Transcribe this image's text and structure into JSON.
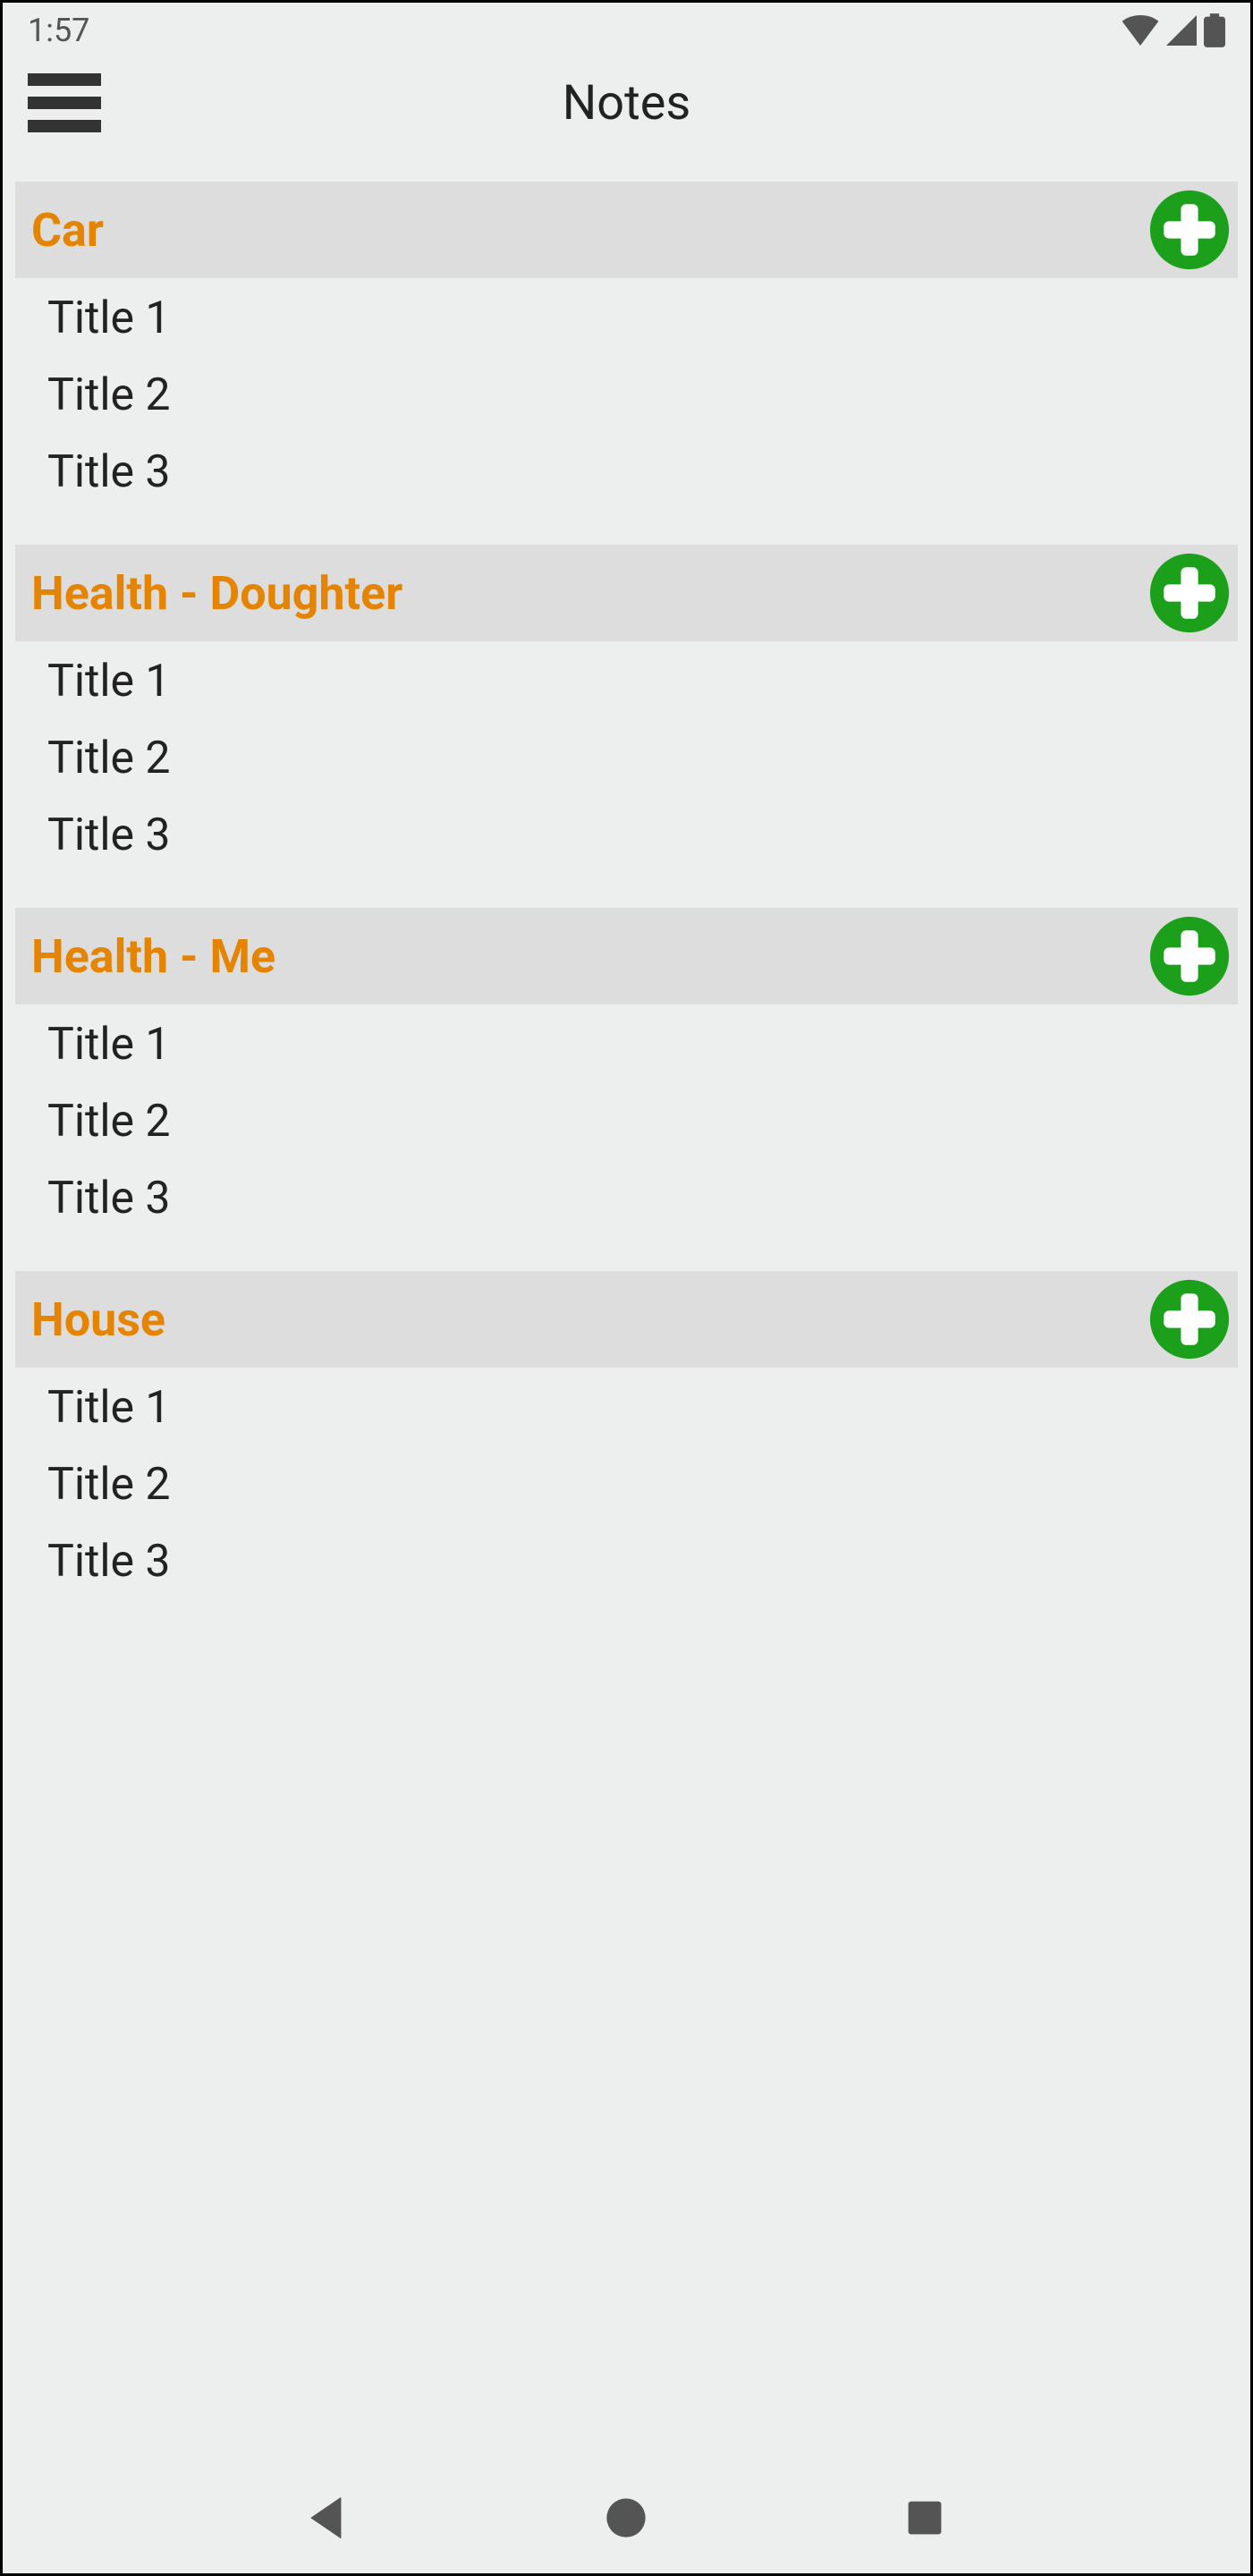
{
  "statusBar": {
    "time": "1:57"
  },
  "header": {
    "title": "Notes"
  },
  "categories": [
    {
      "name": "Car",
      "items": [
        "Title 1",
        "Title 2",
        "Title 3"
      ]
    },
    {
      "name": "Health - Doughter",
      "items": [
        "Title 1",
        "Title 2",
        "Title 3"
      ]
    },
    {
      "name": "Health - Me",
      "items": [
        "Title 1",
        "Title 2",
        "Title 3"
      ]
    },
    {
      "name": "House",
      "items": [
        "Title 1",
        "Title 2",
        "Title 3"
      ]
    }
  ]
}
